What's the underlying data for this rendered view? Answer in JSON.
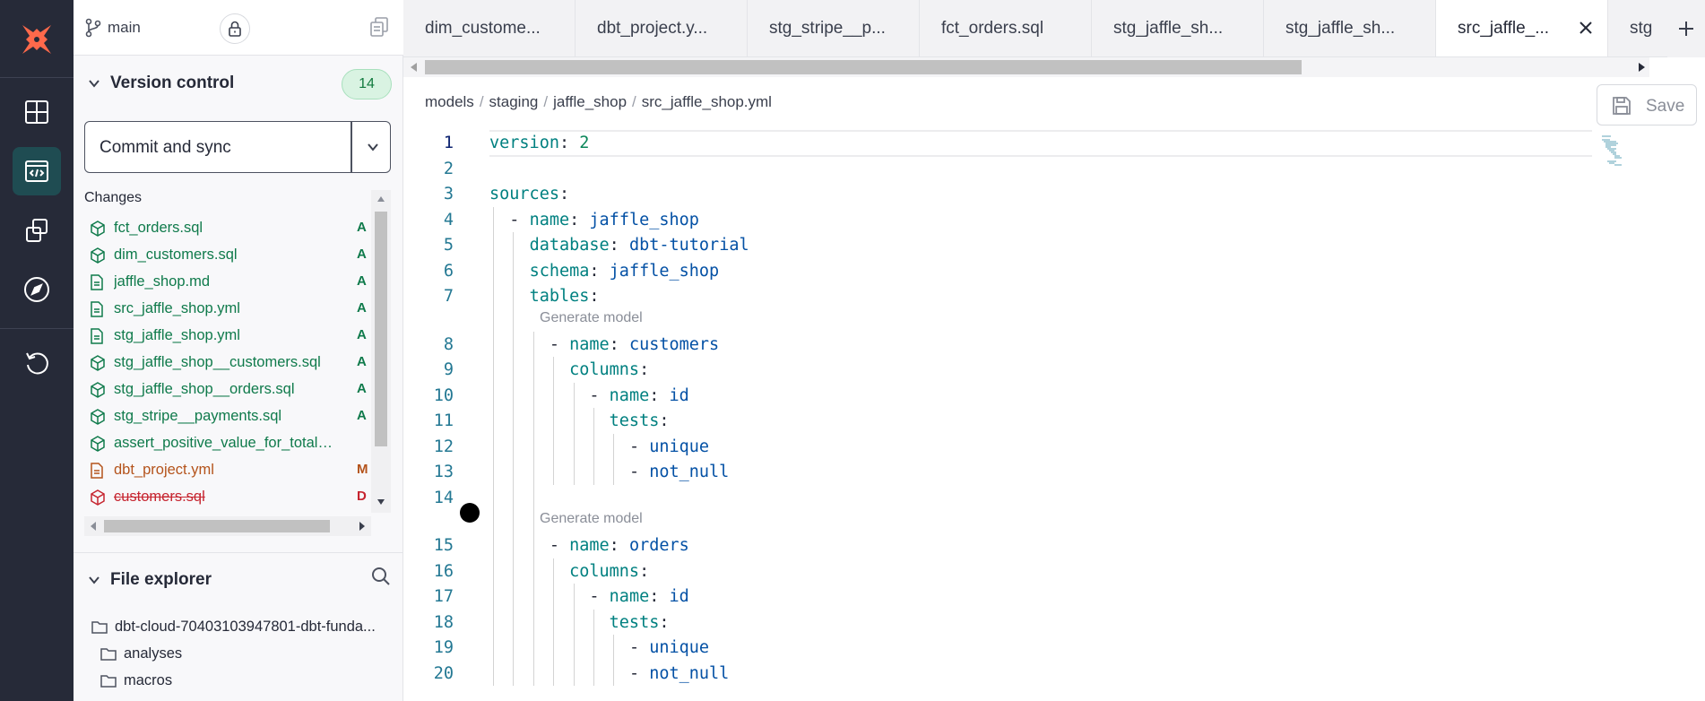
{
  "branch": {
    "name": "main"
  },
  "rail": {
    "icons": [
      "dbt-logo-icon",
      "grid-icon",
      "code-editor-icon",
      "copy-objects-icon",
      "compass-icon",
      "undo-icon"
    ]
  },
  "version_control": {
    "title": "Version control",
    "count": "14",
    "commit_label": "Commit and sync",
    "changes_title": "Changes",
    "changes": [
      {
        "name": "fct_orders.sql",
        "status": "A",
        "kind": "model"
      },
      {
        "name": "dim_customers.sql",
        "status": "A",
        "kind": "model"
      },
      {
        "name": "jaffle_shop.md",
        "status": "A",
        "kind": "doc"
      },
      {
        "name": "src_jaffle_shop.yml",
        "status": "A",
        "kind": "doc"
      },
      {
        "name": "stg_jaffle_shop.yml",
        "status": "A",
        "kind": "doc"
      },
      {
        "name": "stg_jaffle_shop__customers.sql",
        "status": "A",
        "kind": "model"
      },
      {
        "name": "stg_jaffle_shop__orders.sql",
        "status": "A",
        "kind": "model"
      },
      {
        "name": "stg_stripe__payments.sql",
        "status": "A",
        "kind": "model"
      },
      {
        "name": "assert_positive_value_for_total_a...",
        "status": "",
        "kind": "model"
      },
      {
        "name": "dbt_project.yml",
        "status": "M",
        "kind": "doc"
      },
      {
        "name": "customers.sql",
        "status": "D",
        "kind": "model"
      }
    ]
  },
  "file_explorer": {
    "title": "File explorer",
    "items": [
      {
        "name": "dbt-cloud-70403103947801-dbt-funda..."
      },
      {
        "name": "analyses"
      },
      {
        "name": "macros"
      }
    ]
  },
  "tabs": [
    {
      "label": "dim_custome...",
      "active": false
    },
    {
      "label": "dbt_project.y...",
      "active": false
    },
    {
      "label": "stg_stripe__p...",
      "active": false
    },
    {
      "label": "fct_orders.sql",
      "active": false
    },
    {
      "label": "stg_jaffle_sh...",
      "active": false
    },
    {
      "label": "stg_jaffle_sh...",
      "active": false
    },
    {
      "label": "src_jaffle_...",
      "active": true
    },
    {
      "label": "stg",
      "active": false
    }
  ],
  "breadcrumb": [
    "models",
    "staging",
    "jaffle_shop",
    "src_jaffle_shop.yml"
  ],
  "save_label": "Save",
  "codelens_label": "Generate model",
  "code_lines": [
    {
      "n": "1",
      "indent": "",
      "dash": false,
      "key": "version",
      "value": "2",
      "vtype": "num"
    },
    {
      "n": "2",
      "indent": "",
      "dash": false,
      "key": "",
      "value": "",
      "vtype": ""
    },
    {
      "n": "3",
      "indent": "",
      "dash": false,
      "key": "sources",
      "value": "",
      "vtype": ""
    },
    {
      "n": "4",
      "indent": "  ",
      "dash": true,
      "key": "name",
      "value": "jaffle_shop",
      "vtype": "str"
    },
    {
      "n": "5",
      "indent": "    ",
      "dash": false,
      "key": "database",
      "value": "dbt-tutorial",
      "vtype": "str"
    },
    {
      "n": "6",
      "indent": "    ",
      "dash": false,
      "key": "schema",
      "value": "jaffle_shop",
      "vtype": "str"
    },
    {
      "n": "7",
      "indent": "    ",
      "dash": false,
      "key": "tables",
      "value": "",
      "vtype": ""
    },
    {
      "n": "8",
      "indent": "      ",
      "dash": true,
      "key": "name",
      "value": "customers",
      "vtype": "str"
    },
    {
      "n": "9",
      "indent": "        ",
      "dash": false,
      "key": "columns",
      "value": "",
      "vtype": ""
    },
    {
      "n": "10",
      "indent": "          ",
      "dash": true,
      "key": "name",
      "value": "id",
      "vtype": "str"
    },
    {
      "n": "11",
      "indent": "            ",
      "dash": false,
      "key": "tests",
      "value": "",
      "vtype": ""
    },
    {
      "n": "12",
      "indent": "              ",
      "dash": true,
      "key": "",
      "value": "unique",
      "vtype": "str"
    },
    {
      "n": "13",
      "indent": "              ",
      "dash": true,
      "key": "",
      "value": "not_null",
      "vtype": "str"
    },
    {
      "n": "14",
      "indent": "",
      "dash": false,
      "key": "",
      "value": "",
      "vtype": ""
    },
    {
      "n": "15",
      "indent": "      ",
      "dash": true,
      "key": "name",
      "value": "orders",
      "vtype": "str"
    },
    {
      "n": "16",
      "indent": "        ",
      "dash": false,
      "key": "columns",
      "value": "",
      "vtype": ""
    },
    {
      "n": "17",
      "indent": "          ",
      "dash": true,
      "key": "name",
      "value": "id",
      "vtype": "str"
    },
    {
      "n": "18",
      "indent": "            ",
      "dash": false,
      "key": "tests",
      "value": "",
      "vtype": ""
    },
    {
      "n": "19",
      "indent": "              ",
      "dash": true,
      "key": "",
      "value": "unique",
      "vtype": "str"
    },
    {
      "n": "20",
      "indent": "              ",
      "dash": true,
      "key": "",
      "value": "not_null",
      "vtype": "str"
    }
  ],
  "colors": {
    "accent": "#ff694b",
    "rail": "#262a38",
    "added": "#0f7a4b",
    "modified": "#b4531b",
    "deleted": "#c6242f"
  }
}
